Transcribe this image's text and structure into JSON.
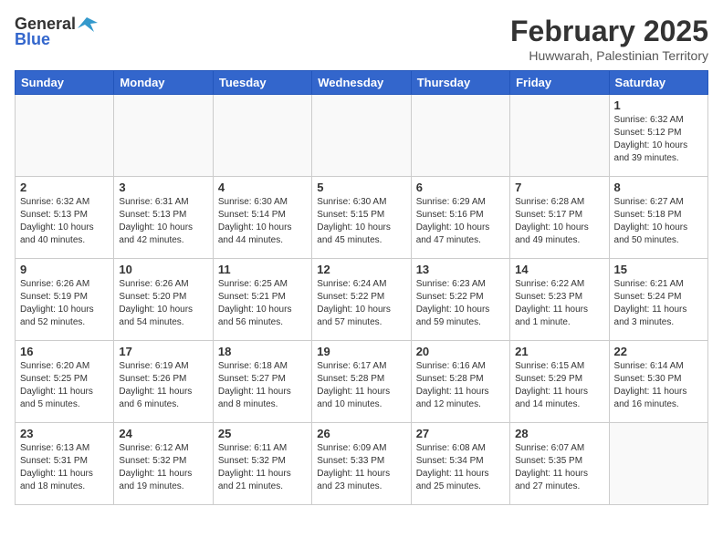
{
  "header": {
    "logo_general": "General",
    "logo_blue": "Blue",
    "title": "February 2025",
    "subtitle": "Huwwarah, Palestinian Territory"
  },
  "weekdays": [
    "Sunday",
    "Monday",
    "Tuesday",
    "Wednesday",
    "Thursday",
    "Friday",
    "Saturday"
  ],
  "weeks": [
    [
      {
        "day": "",
        "info": ""
      },
      {
        "day": "",
        "info": ""
      },
      {
        "day": "",
        "info": ""
      },
      {
        "day": "",
        "info": ""
      },
      {
        "day": "",
        "info": ""
      },
      {
        "day": "",
        "info": ""
      },
      {
        "day": "1",
        "info": "Sunrise: 6:32 AM\nSunset: 5:12 PM\nDaylight: 10 hours and 39 minutes."
      }
    ],
    [
      {
        "day": "2",
        "info": "Sunrise: 6:32 AM\nSunset: 5:13 PM\nDaylight: 10 hours and 40 minutes."
      },
      {
        "day": "3",
        "info": "Sunrise: 6:31 AM\nSunset: 5:13 PM\nDaylight: 10 hours and 42 minutes."
      },
      {
        "day": "4",
        "info": "Sunrise: 6:30 AM\nSunset: 5:14 PM\nDaylight: 10 hours and 44 minutes."
      },
      {
        "day": "5",
        "info": "Sunrise: 6:30 AM\nSunset: 5:15 PM\nDaylight: 10 hours and 45 minutes."
      },
      {
        "day": "6",
        "info": "Sunrise: 6:29 AM\nSunset: 5:16 PM\nDaylight: 10 hours and 47 minutes."
      },
      {
        "day": "7",
        "info": "Sunrise: 6:28 AM\nSunset: 5:17 PM\nDaylight: 10 hours and 49 minutes."
      },
      {
        "day": "8",
        "info": "Sunrise: 6:27 AM\nSunset: 5:18 PM\nDaylight: 10 hours and 50 minutes."
      }
    ],
    [
      {
        "day": "9",
        "info": "Sunrise: 6:26 AM\nSunset: 5:19 PM\nDaylight: 10 hours and 52 minutes."
      },
      {
        "day": "10",
        "info": "Sunrise: 6:26 AM\nSunset: 5:20 PM\nDaylight: 10 hours and 54 minutes."
      },
      {
        "day": "11",
        "info": "Sunrise: 6:25 AM\nSunset: 5:21 PM\nDaylight: 10 hours and 56 minutes."
      },
      {
        "day": "12",
        "info": "Sunrise: 6:24 AM\nSunset: 5:22 PM\nDaylight: 10 hours and 57 minutes."
      },
      {
        "day": "13",
        "info": "Sunrise: 6:23 AM\nSunset: 5:22 PM\nDaylight: 10 hours and 59 minutes."
      },
      {
        "day": "14",
        "info": "Sunrise: 6:22 AM\nSunset: 5:23 PM\nDaylight: 11 hours and 1 minute."
      },
      {
        "day": "15",
        "info": "Sunrise: 6:21 AM\nSunset: 5:24 PM\nDaylight: 11 hours and 3 minutes."
      }
    ],
    [
      {
        "day": "16",
        "info": "Sunrise: 6:20 AM\nSunset: 5:25 PM\nDaylight: 11 hours and 5 minutes."
      },
      {
        "day": "17",
        "info": "Sunrise: 6:19 AM\nSunset: 5:26 PM\nDaylight: 11 hours and 6 minutes."
      },
      {
        "day": "18",
        "info": "Sunrise: 6:18 AM\nSunset: 5:27 PM\nDaylight: 11 hours and 8 minutes."
      },
      {
        "day": "19",
        "info": "Sunrise: 6:17 AM\nSunset: 5:28 PM\nDaylight: 11 hours and 10 minutes."
      },
      {
        "day": "20",
        "info": "Sunrise: 6:16 AM\nSunset: 5:28 PM\nDaylight: 11 hours and 12 minutes."
      },
      {
        "day": "21",
        "info": "Sunrise: 6:15 AM\nSunset: 5:29 PM\nDaylight: 11 hours and 14 minutes."
      },
      {
        "day": "22",
        "info": "Sunrise: 6:14 AM\nSunset: 5:30 PM\nDaylight: 11 hours and 16 minutes."
      }
    ],
    [
      {
        "day": "23",
        "info": "Sunrise: 6:13 AM\nSunset: 5:31 PM\nDaylight: 11 hours and 18 minutes."
      },
      {
        "day": "24",
        "info": "Sunrise: 6:12 AM\nSunset: 5:32 PM\nDaylight: 11 hours and 19 minutes."
      },
      {
        "day": "25",
        "info": "Sunrise: 6:11 AM\nSunset: 5:32 PM\nDaylight: 11 hours and 21 minutes."
      },
      {
        "day": "26",
        "info": "Sunrise: 6:09 AM\nSunset: 5:33 PM\nDaylight: 11 hours and 23 minutes."
      },
      {
        "day": "27",
        "info": "Sunrise: 6:08 AM\nSunset: 5:34 PM\nDaylight: 11 hours and 25 minutes."
      },
      {
        "day": "28",
        "info": "Sunrise: 6:07 AM\nSunset: 5:35 PM\nDaylight: 11 hours and 27 minutes."
      },
      {
        "day": "",
        "info": ""
      }
    ]
  ]
}
